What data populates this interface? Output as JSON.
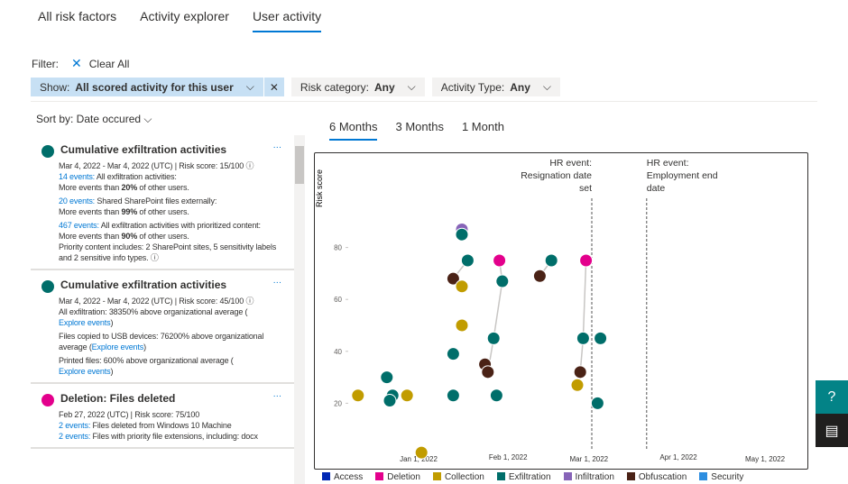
{
  "tabs": [
    "All risk factors",
    "Activity explorer",
    "User activity"
  ],
  "filter": {
    "label": "Filter:",
    "clear": "Clear All"
  },
  "chips": {
    "show_label": "Show:",
    "show_value": "All scored activity for this user",
    "risk_label": "Risk category:",
    "risk_value": "Any",
    "type_label": "Activity Type:",
    "type_value": "Any"
  },
  "sort": "Sort by: Date occured",
  "cards": [
    {
      "title": "Cumulative exfiltration activities",
      "color": "#006e6a",
      "date": "Mar 4, 2022 - Mar 4, 2022 (UTC) | Risk score: 15/100",
      "l1a": "14 events:",
      "l1b": " All exfiltration activities:",
      "l1c": "More events than ",
      "l1d": "20%",
      "l1e": " of other users.",
      "l2a": "20 events:",
      "l2b": " Shared SharePoint files externally:",
      "l2c": "More events than ",
      "l2d": "99%",
      "l2e": " of other users.",
      "l3a": "467 events:",
      "l3b": " All exfiltration activities with prioritized content:",
      "l3c": "More events than ",
      "l3d": "90%",
      "l3e": " of other users.",
      "l4": "Priority content includes: 2 SharePoint sites, 5 sensitivity labels and 2 sensitive info types."
    },
    {
      "title": "Cumulative exfiltration activities",
      "color": "#006e6a",
      "date": "Mar 4, 2022 - Mar 4, 2022 (UTC) | Risk score: 45/100",
      "a": "All exfiltration: 38350% above organizational average (",
      "b": "Files copied to USB devices: 76200% above organizational average (",
      "c": "Printed files: 600% above organizational average (",
      "explore": "Explore events",
      "close": ")"
    },
    {
      "title": "Deletion: Files deleted",
      "color": "#e3008c",
      "date": "Feb 27, 2022 (UTC) | Risk score: 75/100",
      "l1a": "2 events:",
      "l1b": " Files deleted from Windows 10 Machine",
      "l2a": "2 events:",
      "l2b": " Files with priority file extensions, including: docx"
    }
  ],
  "chart_tabs": [
    "6 Months",
    "3 Months",
    "1 Month"
  ],
  "chart_data": {
    "type": "scatter",
    "ylabel": "Risk score",
    "yticks": [
      20,
      40,
      60,
      80
    ],
    "ylim": [
      0,
      100
    ],
    "xticks": [
      {
        "label": "Jan 1, 2022",
        "day": 0
      },
      {
        "label": "Feb 1, 2022",
        "day": 31
      },
      {
        "label": "Mar 1, 2022",
        "day": 59
      },
      {
        "label": "Apr 1, 2022",
        "day": 90
      },
      {
        "label": "May 1, 2022",
        "day": 120
      }
    ],
    "xlim_days": [
      -21,
      150
    ],
    "annotations": [
      {
        "day": 60,
        "lines": [
          "HR event:",
          "Resignation date",
          "set"
        ],
        "align": "right"
      },
      {
        "day": 79,
        "lines": [
          "HR event:",
          "Employment end",
          "date"
        ],
        "align": "left"
      }
    ],
    "categories": [
      {
        "name": "Access",
        "color": "#0027b4"
      },
      {
        "name": "Deletion",
        "color": "#e3008c"
      },
      {
        "name": "Collection",
        "color": "#c19c00"
      },
      {
        "name": "Exfiltration",
        "color": "#006e6a"
      },
      {
        "name": "Infiltration",
        "color": "#8764b8"
      },
      {
        "name": "Obfuscation",
        "color": "#4a2216"
      },
      {
        "name": "Security",
        "color": "#2d8ee0"
      }
    ],
    "points": [
      {
        "day": -21,
        "score": 23,
        "cat": "Collection"
      },
      {
        "day": -11,
        "score": 30,
        "cat": "Exfiltration"
      },
      {
        "day": -9,
        "score": 23,
        "cat": "Exfiltration"
      },
      {
        "day": -10,
        "score": 21,
        "cat": "Exfiltration"
      },
      {
        "day": -4,
        "score": 23,
        "cat": "Collection"
      },
      {
        "day": 1,
        "score": 1,
        "cat": "Collection"
      },
      {
        "day": 12,
        "score": 23,
        "cat": "Exfiltration"
      },
      {
        "day": 12,
        "score": 39,
        "cat": "Exfiltration"
      },
      {
        "day": 12,
        "score": 68,
        "cat": "Obfuscation"
      },
      {
        "day": 15,
        "score": 87,
        "cat": "Infiltration"
      },
      {
        "day": 15,
        "score": 85,
        "cat": "Exfiltration"
      },
      {
        "day": 17,
        "score": 75,
        "cat": "Exfiltration"
      },
      {
        "day": 15,
        "score": 65,
        "cat": "Collection"
      },
      {
        "day": 15,
        "score": 50,
        "cat": "Collection"
      },
      {
        "day": 23,
        "score": 35,
        "cat": "Obfuscation"
      },
      {
        "day": 24,
        "score": 32,
        "cat": "Obfuscation"
      },
      {
        "day": 26,
        "score": 45,
        "cat": "Exfiltration"
      },
      {
        "day": 27,
        "score": 23,
        "cat": "Exfiltration"
      },
      {
        "day": 28,
        "score": 75,
        "cat": "Deletion"
      },
      {
        "day": 29,
        "score": 67,
        "cat": "Exfiltration"
      },
      {
        "day": 42,
        "score": 69,
        "cat": "Obfuscation"
      },
      {
        "day": 46,
        "score": 75,
        "cat": "Exfiltration"
      },
      {
        "day": 55,
        "score": 27,
        "cat": "Collection"
      },
      {
        "day": 56,
        "score": 32,
        "cat": "Obfuscation"
      },
      {
        "day": 57,
        "score": 45,
        "cat": "Exfiltration"
      },
      {
        "day": 58,
        "score": 75,
        "cat": "Deletion"
      },
      {
        "day": 63,
        "score": 45,
        "cat": "Exfiltration"
      },
      {
        "day": 62,
        "score": 20,
        "cat": "Exfiltration"
      }
    ],
    "links": [
      [
        [
          12,
          68
        ],
        [
          17,
          75
        ]
      ],
      [
        [
          28,
          75
        ],
        [
          29,
          67
        ],
        [
          26,
          45
        ],
        [
          24,
          32
        ]
      ],
      [
        [
          42,
          69
        ],
        [
          46,
          75
        ]
      ],
      [
        [
          58,
          75
        ],
        [
          57,
          45
        ],
        [
          56,
          32
        ]
      ]
    ]
  }
}
